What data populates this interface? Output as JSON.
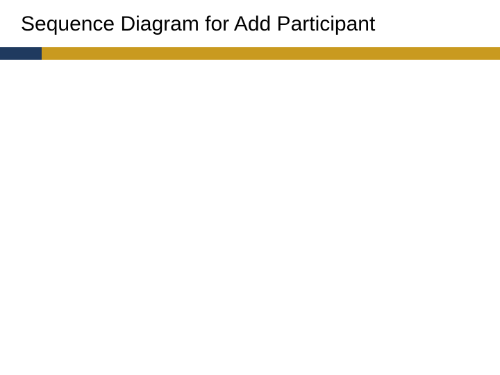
{
  "slide": {
    "title": "Sequence Diagram for Add Participant"
  },
  "colors": {
    "accent_left": "#1f3a5f",
    "accent_right": "#c99a1f"
  }
}
